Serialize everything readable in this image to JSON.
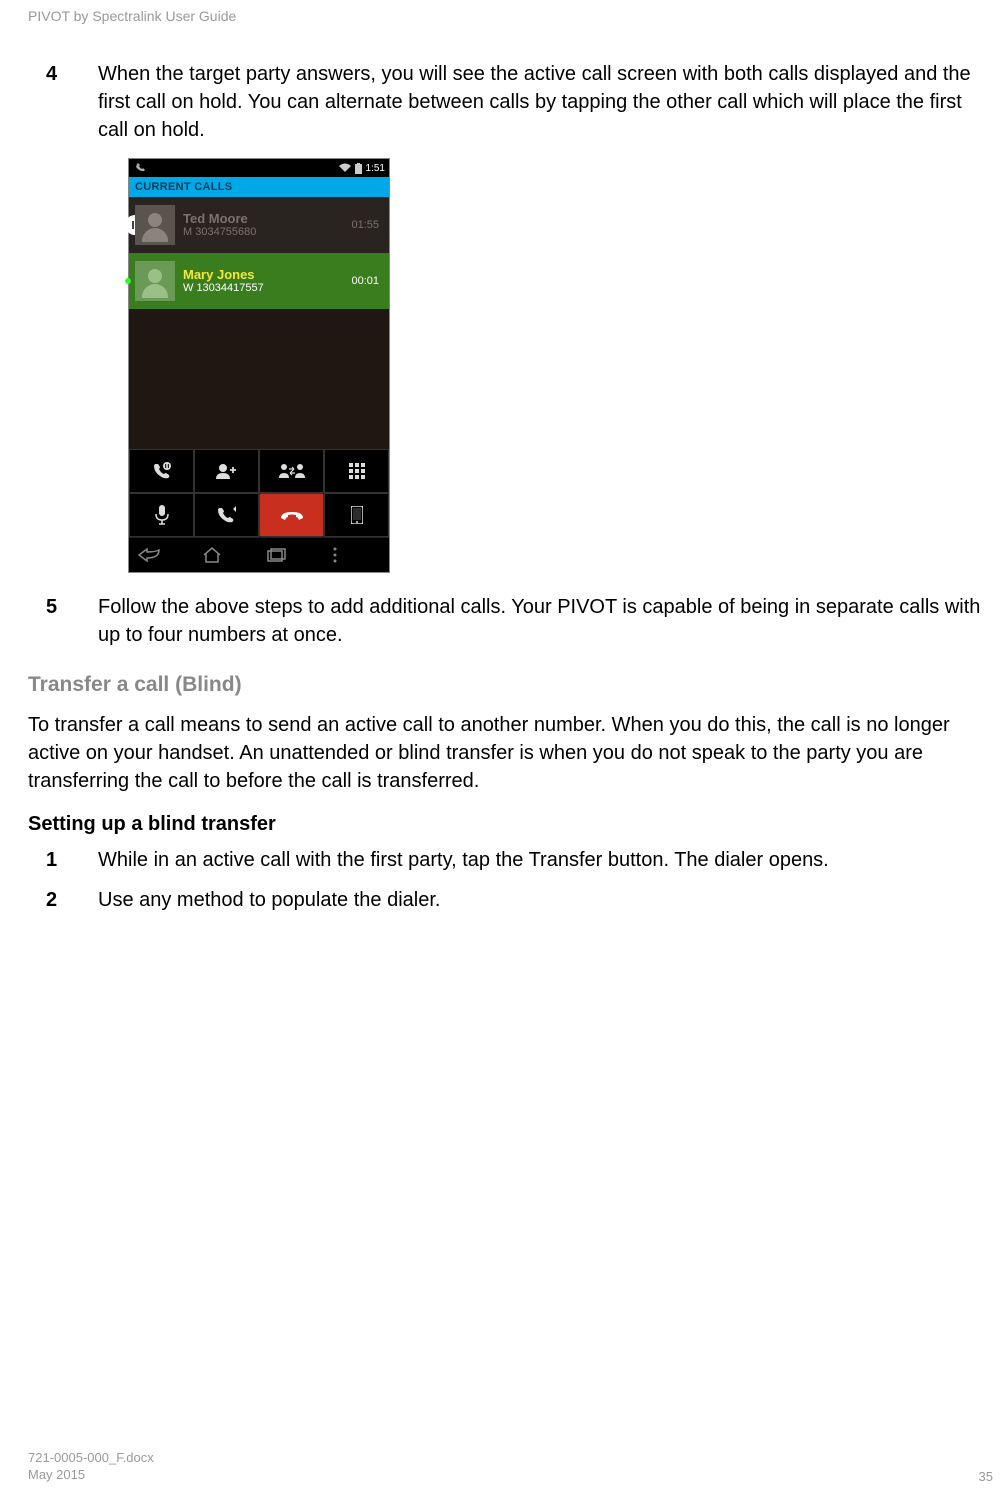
{
  "header": {
    "title": "PIVOT by Spectralink User Guide"
  },
  "steps_a": [
    {
      "num": "4",
      "text": "When the target party answers, you will see the active call screen with both calls displayed and the first call on hold. You can alternate between calls by tapping the other call which will place the first call on hold."
    }
  ],
  "screenshot": {
    "status_time": "1:51",
    "banner": "CURRENT CALLS",
    "held": {
      "name": "Ted Moore",
      "number": "M 3034755680",
      "time": "01:55"
    },
    "active": {
      "name": "Mary Jones",
      "number": "W 13034417557",
      "time": "00:01"
    }
  },
  "steps_b": [
    {
      "num": "5",
      "text": "Follow the above steps to add additional calls. Your PIVOT is capable of being in separate calls with up to four numbers at once."
    }
  ],
  "section": {
    "title": "Transfer a call (Blind)"
  },
  "para1": "To transfer a call means to send an active call to another number. When you do this, the call is no longer active on your handset. An unattended or blind transfer is when you do not speak to the party you are transferring the call to before the call is transferred.",
  "sub": "Setting up a blind transfer",
  "steps_c": [
    {
      "num": "1",
      "text": "While in an active call with the first party, tap the Transfer button. The dialer opens."
    },
    {
      "num": "2",
      "text": "Use any method to populate the dialer."
    }
  ],
  "footer": {
    "doc": "721-0005-000_F.docx",
    "date": "May 2015",
    "page": "35"
  }
}
